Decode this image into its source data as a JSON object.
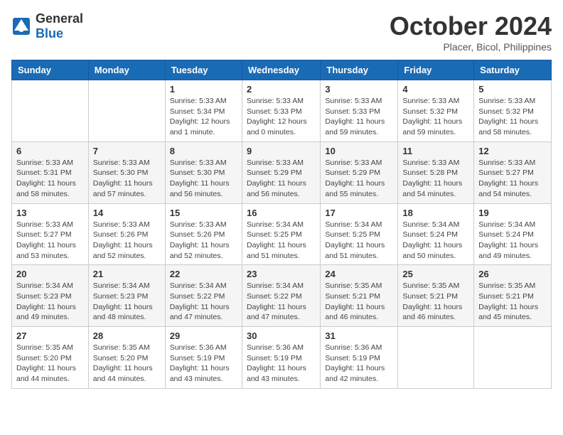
{
  "logo": {
    "general": "General",
    "blue": "Blue"
  },
  "title": {
    "month": "October 2024",
    "location": "Placer, Bicol, Philippines"
  },
  "weekdays": [
    "Sunday",
    "Monday",
    "Tuesday",
    "Wednesday",
    "Thursday",
    "Friday",
    "Saturday"
  ],
  "weeks": [
    [
      {
        "day": "",
        "info": ""
      },
      {
        "day": "",
        "info": ""
      },
      {
        "day": "1",
        "info": "Sunrise: 5:33 AM\nSunset: 5:34 PM\nDaylight: 12 hours\nand 1 minute."
      },
      {
        "day": "2",
        "info": "Sunrise: 5:33 AM\nSunset: 5:33 PM\nDaylight: 12 hours\nand 0 minutes."
      },
      {
        "day": "3",
        "info": "Sunrise: 5:33 AM\nSunset: 5:33 PM\nDaylight: 11 hours\nand 59 minutes."
      },
      {
        "day": "4",
        "info": "Sunrise: 5:33 AM\nSunset: 5:32 PM\nDaylight: 11 hours\nand 59 minutes."
      },
      {
        "day": "5",
        "info": "Sunrise: 5:33 AM\nSunset: 5:32 PM\nDaylight: 11 hours\nand 58 minutes."
      }
    ],
    [
      {
        "day": "6",
        "info": "Sunrise: 5:33 AM\nSunset: 5:31 PM\nDaylight: 11 hours\nand 58 minutes."
      },
      {
        "day": "7",
        "info": "Sunrise: 5:33 AM\nSunset: 5:30 PM\nDaylight: 11 hours\nand 57 minutes."
      },
      {
        "day": "8",
        "info": "Sunrise: 5:33 AM\nSunset: 5:30 PM\nDaylight: 11 hours\nand 56 minutes."
      },
      {
        "day": "9",
        "info": "Sunrise: 5:33 AM\nSunset: 5:29 PM\nDaylight: 11 hours\nand 56 minutes."
      },
      {
        "day": "10",
        "info": "Sunrise: 5:33 AM\nSunset: 5:29 PM\nDaylight: 11 hours\nand 55 minutes."
      },
      {
        "day": "11",
        "info": "Sunrise: 5:33 AM\nSunset: 5:28 PM\nDaylight: 11 hours\nand 54 minutes."
      },
      {
        "day": "12",
        "info": "Sunrise: 5:33 AM\nSunset: 5:27 PM\nDaylight: 11 hours\nand 54 minutes."
      }
    ],
    [
      {
        "day": "13",
        "info": "Sunrise: 5:33 AM\nSunset: 5:27 PM\nDaylight: 11 hours\nand 53 minutes."
      },
      {
        "day": "14",
        "info": "Sunrise: 5:33 AM\nSunset: 5:26 PM\nDaylight: 11 hours\nand 52 minutes."
      },
      {
        "day": "15",
        "info": "Sunrise: 5:33 AM\nSunset: 5:26 PM\nDaylight: 11 hours\nand 52 minutes."
      },
      {
        "day": "16",
        "info": "Sunrise: 5:34 AM\nSunset: 5:25 PM\nDaylight: 11 hours\nand 51 minutes."
      },
      {
        "day": "17",
        "info": "Sunrise: 5:34 AM\nSunset: 5:25 PM\nDaylight: 11 hours\nand 51 minutes."
      },
      {
        "day": "18",
        "info": "Sunrise: 5:34 AM\nSunset: 5:24 PM\nDaylight: 11 hours\nand 50 minutes."
      },
      {
        "day": "19",
        "info": "Sunrise: 5:34 AM\nSunset: 5:24 PM\nDaylight: 11 hours\nand 49 minutes."
      }
    ],
    [
      {
        "day": "20",
        "info": "Sunrise: 5:34 AM\nSunset: 5:23 PM\nDaylight: 11 hours\nand 49 minutes."
      },
      {
        "day": "21",
        "info": "Sunrise: 5:34 AM\nSunset: 5:23 PM\nDaylight: 11 hours\nand 48 minutes."
      },
      {
        "day": "22",
        "info": "Sunrise: 5:34 AM\nSunset: 5:22 PM\nDaylight: 11 hours\nand 47 minutes."
      },
      {
        "day": "23",
        "info": "Sunrise: 5:34 AM\nSunset: 5:22 PM\nDaylight: 11 hours\nand 47 minutes."
      },
      {
        "day": "24",
        "info": "Sunrise: 5:35 AM\nSunset: 5:21 PM\nDaylight: 11 hours\nand 46 minutes."
      },
      {
        "day": "25",
        "info": "Sunrise: 5:35 AM\nSunset: 5:21 PM\nDaylight: 11 hours\nand 46 minutes."
      },
      {
        "day": "26",
        "info": "Sunrise: 5:35 AM\nSunset: 5:21 PM\nDaylight: 11 hours\nand 45 minutes."
      }
    ],
    [
      {
        "day": "27",
        "info": "Sunrise: 5:35 AM\nSunset: 5:20 PM\nDaylight: 11 hours\nand 44 minutes."
      },
      {
        "day": "28",
        "info": "Sunrise: 5:35 AM\nSunset: 5:20 PM\nDaylight: 11 hours\nand 44 minutes."
      },
      {
        "day": "29",
        "info": "Sunrise: 5:36 AM\nSunset: 5:19 PM\nDaylight: 11 hours\nand 43 minutes."
      },
      {
        "day": "30",
        "info": "Sunrise: 5:36 AM\nSunset: 5:19 PM\nDaylight: 11 hours\nand 43 minutes."
      },
      {
        "day": "31",
        "info": "Sunrise: 5:36 AM\nSunset: 5:19 PM\nDaylight: 11 hours\nand 42 minutes."
      },
      {
        "day": "",
        "info": ""
      },
      {
        "day": "",
        "info": ""
      }
    ]
  ]
}
